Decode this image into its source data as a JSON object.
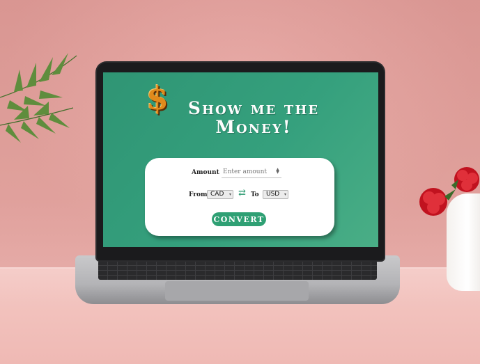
{
  "app": {
    "title_line1": "Show me the",
    "title_line2": "Money!",
    "logo_glyph": "$"
  },
  "form": {
    "amount_label": "Amount",
    "amount_placeholder": "Enter amount",
    "amount_value": "",
    "from_label": "From",
    "from_value": "CAD",
    "to_label": "To",
    "to_value": "USD",
    "swap_icon": "⇄",
    "convert_label": "CONVERT"
  },
  "colors": {
    "screen_bg": "#35a07d",
    "button_bg": "#2fa074",
    "accent": "#2d9b72"
  }
}
